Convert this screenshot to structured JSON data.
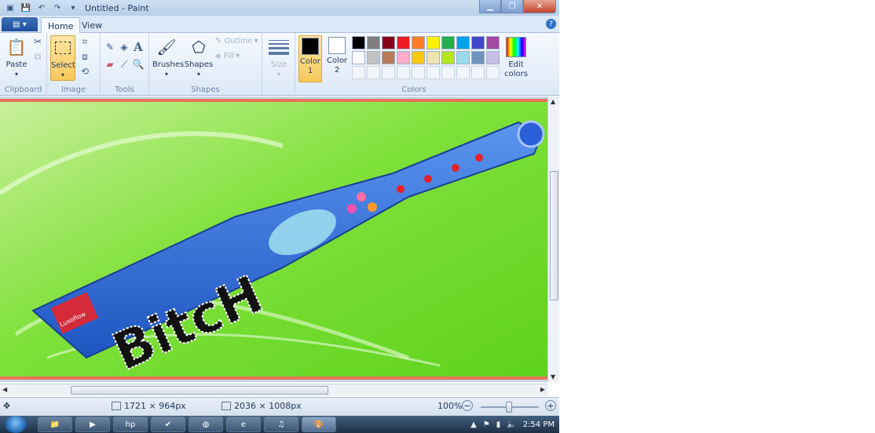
{
  "window": {
    "title": "Untitled - Paint",
    "colors": {
      "title_bg": "#b7cfea",
      "accent": "#1d4f9e",
      "selected": "#f8c85c"
    }
  },
  "quick_access": {
    "icons": [
      "paint-app-icon",
      "save-icon",
      "undo-icon",
      "redo-icon",
      "customize-dropdown-icon"
    ]
  },
  "tabs": [
    {
      "label": "Home",
      "active": true
    },
    {
      "label": "View",
      "active": false
    }
  ],
  "ribbon": {
    "clipboard": {
      "paste": "Paste",
      "group": "Clipboard"
    },
    "image": {
      "select": "Select",
      "group": "Image"
    },
    "tools": {
      "group": "Tools"
    },
    "shapes": {
      "brushes": "Brushes",
      "shapes": "Shapes",
      "outline": "Outline",
      "fill": "Fill",
      "group": "Shapes"
    },
    "size": {
      "label": "Size"
    },
    "colors": {
      "color1_line1": "Color",
      "color1_line2": "1",
      "color2_line1": "Color",
      "color2_line2": "2",
      "edit_line1": "Edit",
      "edit_line2": "colors",
      "group": "Colors",
      "color1": "#000000",
      "color2": "#ffffff",
      "palette_row1": [
        "#000000",
        "#7f7f7f",
        "#880015",
        "#ed1c24",
        "#ff7f27",
        "#fff200",
        "#22b14c",
        "#00a2e8",
        "#3f48cc",
        "#a349a4"
      ],
      "palette_row2": [
        "#ffffff",
        "#c3c3c3",
        "#b97a57",
        "#ffaec9",
        "#ffc90e",
        "#efe4b0",
        "#b5e61d",
        "#99d9ea",
        "#7092be",
        "#c8bfe7"
      ]
    }
  },
  "canvas": {
    "art_text": "BitcH",
    "label_text": "Luxoflow",
    "background": "#7ee03a",
    "bottle": "#2f6fd6"
  },
  "status": {
    "selection_size": "1721 × 964px",
    "image_size": "2036 × 1008px",
    "zoom": "100%"
  },
  "taskbar": {
    "clock": "2:54 PM"
  }
}
